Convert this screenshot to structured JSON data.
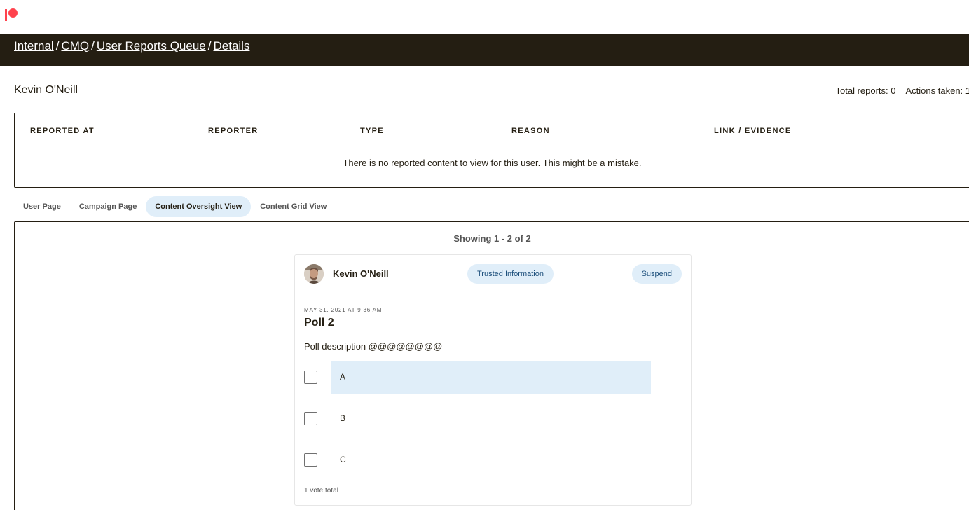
{
  "brand": {
    "logo_icon": "patreon-logo-icon",
    "color": "#ff424d"
  },
  "breadcrumb": {
    "items": [
      "Internal",
      "CMQ",
      "User Reports Queue",
      "Details"
    ],
    "separator": "/"
  },
  "user": {
    "name": "Kevin O'Neill",
    "total_reports": "Total reports: 0",
    "actions_taken": "Actions taken: 1"
  },
  "reports_table": {
    "columns": [
      "REPORTED AT",
      "REPORTER",
      "TYPE",
      "REASON",
      "LINK / EVIDENCE"
    ],
    "empty_message": "There is no reported content to view for this user. This might be a mistake."
  },
  "tabs": {
    "items": [
      "User Page",
      "Campaign Page",
      "Content Oversight View",
      "Content Grid View"
    ],
    "active": "Content Oversight View"
  },
  "content": {
    "showing": "Showing 1 - 2 of 2",
    "post": {
      "author": "Kevin O'Neill",
      "avatar_icon": "avatar",
      "trusted_label": "Trusted Information",
      "suspend_label": "Suspend",
      "date": "MAY 31, 2021 AT 9:36 AM",
      "title": "Poll 2",
      "description": "Poll description @@@@@@@@",
      "options": [
        {
          "label": "A",
          "share": 1.0
        },
        {
          "label": "B",
          "share": 0.0
        },
        {
          "label": "C",
          "share": 0.0
        }
      ],
      "votes": "1 vote total"
    }
  },
  "colors": {
    "dark_brown": "#241e12",
    "accent_light_blue": "#e0eef9",
    "pill_text": "#1a4d7a"
  }
}
